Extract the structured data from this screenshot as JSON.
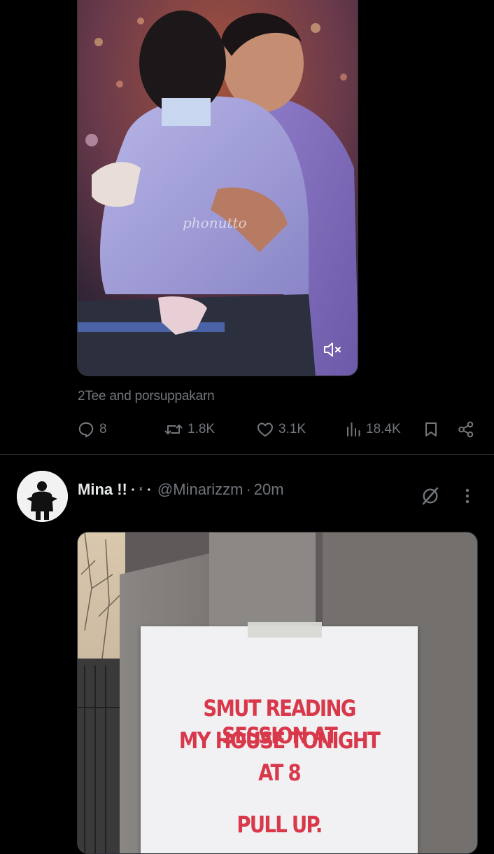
{
  "post1": {
    "tagged_users": "2Tee and porsuppakarn",
    "media_watermark": "phonutto",
    "stats": {
      "replies": "8",
      "reposts": "1.8K",
      "likes": "3.1K",
      "views": "18.4K"
    },
    "icons": {
      "mute": "volume-muted-icon",
      "reply": "reply-icon",
      "repost": "repost-icon",
      "like": "heart-icon",
      "views": "analytics-icon",
      "bookmark": "bookmark-icon",
      "share": "share-icon"
    }
  },
  "post2": {
    "display_name": "Mina !!",
    "name_decoration": "• ˣ •",
    "handle": "@Minarizzm",
    "separator": "·",
    "time": "20m",
    "sign": {
      "line1": "SMUT READING SESSION AT",
      "line2": "MY HOUSE TONIGHT",
      "line3": "AT 8",
      "line4": "PULL UP."
    },
    "icons": {
      "grok": "grok-icon",
      "more": "more-dots-icon"
    }
  },
  "colors": {
    "background": "#000000",
    "text_primary": "#e7e9ea",
    "text_secondary": "#71767b",
    "divider": "#2f3336",
    "sign_text": "#d8384a"
  }
}
